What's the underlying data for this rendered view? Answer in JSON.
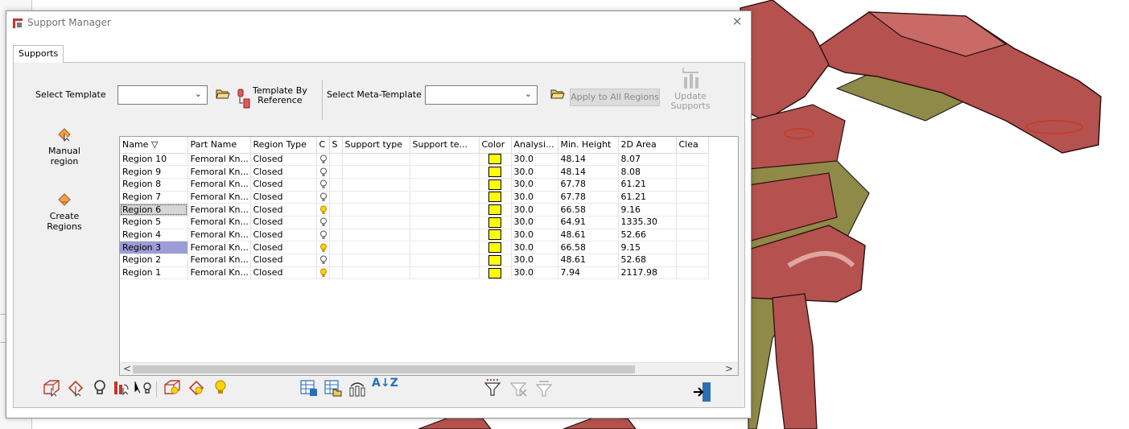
{
  "dialog": {
    "title": "Support Manager",
    "close_glyph": "✕",
    "tab": "Supports"
  },
  "toolbar": {
    "select_template_label": "Select Template",
    "select_template_value": "",
    "template_by_reference_label": "Template By\nReference",
    "select_meta_template_label": "Select Meta-Template",
    "select_meta_template_value": "",
    "apply_all_label": "Apply to All Regions",
    "update_supports_label": "Update\nSupports"
  },
  "side": {
    "manual_region_label": "Manual\nregion",
    "create_regions_label": "Create\nRegions"
  },
  "table": {
    "columns": [
      "Name ▽",
      "Part Name",
      "Region Type",
      "C",
      "S",
      "Support type",
      "Support te...",
      "Color",
      "Analysi...",
      "Min. Height",
      "2D Area",
      "Clea"
    ],
    "rows": [
      {
        "name": "Region 10",
        "part": "Femoral Kn...",
        "type": "Closed",
        "bulb": "off",
        "analysis": "30.0",
        "min_height": "48.14",
        "area": "8.07"
      },
      {
        "name": "Region 9",
        "part": "Femoral Kn...",
        "type": "Closed",
        "bulb": "off",
        "analysis": "30.0",
        "min_height": "48.14",
        "area": "8.08"
      },
      {
        "name": "Region 8",
        "part": "Femoral Kn...",
        "type": "Closed",
        "bulb": "off",
        "analysis": "30.0",
        "min_height": "67.78",
        "area": "61.21"
      },
      {
        "name": "Region 7",
        "part": "Femoral Kn...",
        "type": "Closed",
        "bulb": "off",
        "analysis": "30.0",
        "min_height": "67.78",
        "area": "61.21"
      },
      {
        "name": "Region 6",
        "part": "Femoral Kn...",
        "type": "Closed",
        "bulb": "on",
        "analysis": "30.0",
        "min_height": "66.58",
        "area": "9.16",
        "selected": "focus"
      },
      {
        "name": "Region 5",
        "part": "Femoral Kn...",
        "type": "Closed",
        "bulb": "off",
        "analysis": "30.0",
        "min_height": "64.91",
        "area": "1335.30"
      },
      {
        "name": "Region 4",
        "part": "Femoral Kn...",
        "type": "Closed",
        "bulb": "off",
        "analysis": "30.0",
        "min_height": "48.61",
        "area": "52.66"
      },
      {
        "name": "Region 3",
        "part": "Femoral Kn...",
        "type": "Closed",
        "bulb": "on",
        "analysis": "30.0",
        "min_height": "66.58",
        "area": "9.15",
        "selected": "highlight"
      },
      {
        "name": "Region 2",
        "part": "Femoral Kn...",
        "type": "Closed",
        "bulb": "off",
        "analysis": "30.0",
        "min_height": "48.61",
        "area": "52.68"
      },
      {
        "name": "Region 1",
        "part": "Femoral Kn...",
        "type": "Closed",
        "bulb": "on",
        "analysis": "30.0",
        "min_height": "7.94",
        "area": "2117.98"
      }
    ],
    "swatch_color": "#ffff00",
    "scroll_left": "<",
    "scroll_right": ">"
  },
  "bottom_icons": [
    "box-select-icon",
    "region-select-icon",
    "bulb-off-icon",
    "support-column-icon",
    "pointer-bulb-icon",
    "box-select-highlight-icon",
    "region-select-highlight-icon",
    "bulb-on-icon",
    "save-template-icon",
    "load-template-icon",
    "sort-parts-icon",
    "sort-az-icon",
    "filter-icon",
    "clear-filter-icon",
    "filter-disabled-icon",
    "exit-icon"
  ],
  "sort_az_glyph": "A↓Z",
  "colors": {
    "model_red": "#b5524f",
    "model_green": "#8f8a47",
    "highlight_blue": "#9c9cd8"
  }
}
